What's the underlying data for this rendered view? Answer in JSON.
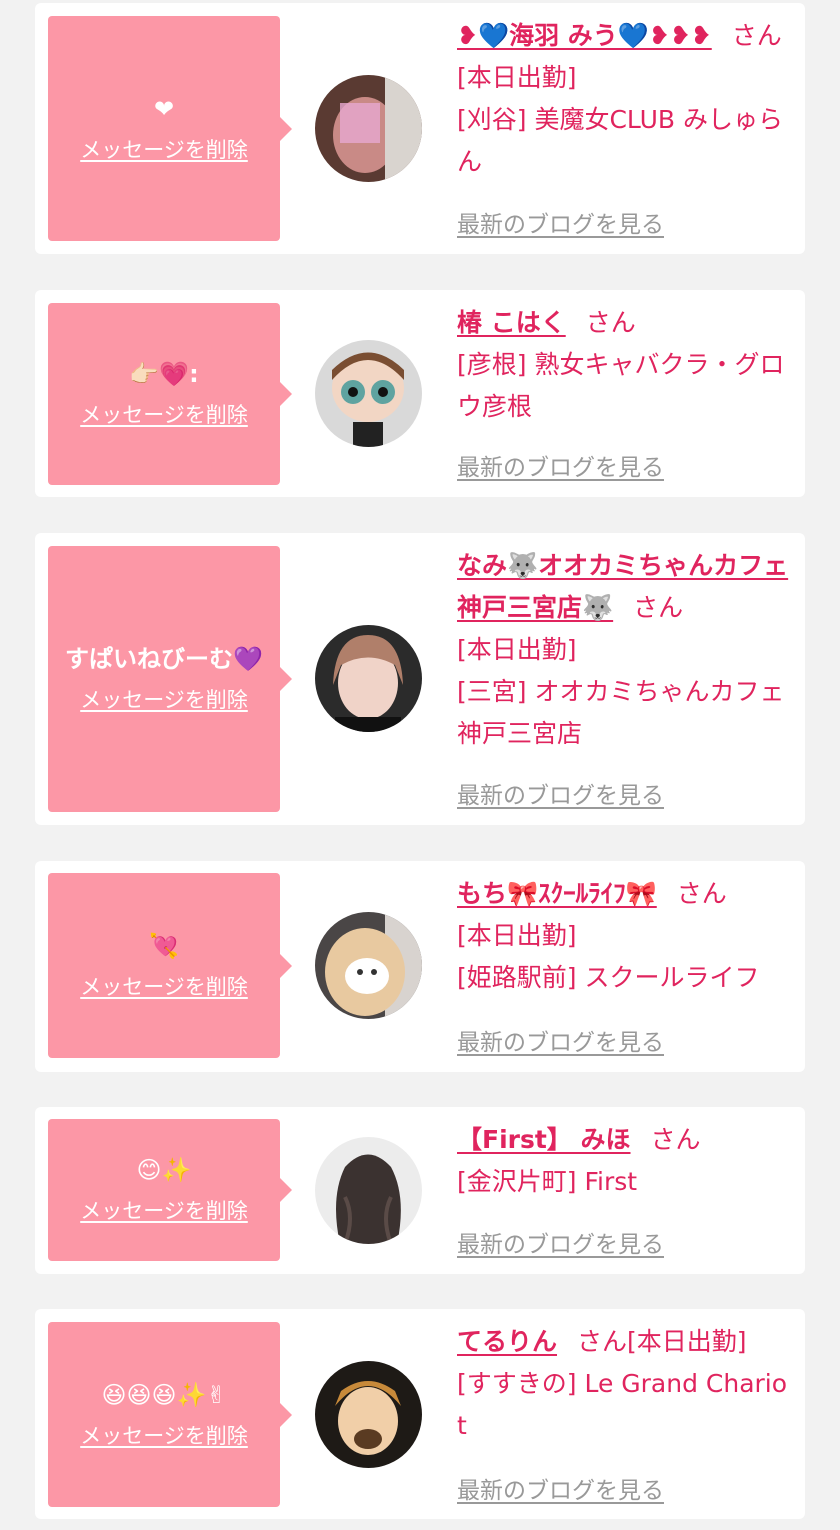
{
  "common": {
    "delete_label": "メッセージを削除",
    "san": "さん",
    "blog_link": "最新のブログを見る"
  },
  "cards": [
    {
      "message": "❤",
      "name": "❥💙海羽 みう💙❥❥❥",
      "status": "[本日出勤]",
      "shop": "[刈谷] 美魔女CLUB みしゅらん"
    },
    {
      "message": "👉🏻💗:",
      "name": "椿 こはく",
      "status": "",
      "shop": "[彦根] 熟女キャバクラ・グロウ彦根"
    },
    {
      "message": "すぱいねびーむ💜",
      "name": "なみ🐺オオカミちゃんカフェ神戸三宮店🐺",
      "status": "[本日出勤]",
      "shop": "[三宮] オオカミちゃんカフェ神戸三宮店"
    },
    {
      "message": "💘",
      "name": "もち🎀ｽｸｰﾙﾗｲﾌ🎀",
      "status": "[本日出勤]",
      "shop": "[姫路駅前] スクールライフ"
    },
    {
      "message": "😊✨",
      "name": "【First】 みほ",
      "status": "",
      "shop": "[金沢片町] First"
    },
    {
      "message": "😆😆😆✨✌",
      "name": "てるりん",
      "status": "[本日出勤]",
      "shop": "[すすきの] Le Grand Chariot"
    }
  ],
  "colors": {
    "bubble": "#fc97a6",
    "accent": "#e0245e",
    "link_gray": "#999999",
    "background": "#f2f2f2"
  }
}
